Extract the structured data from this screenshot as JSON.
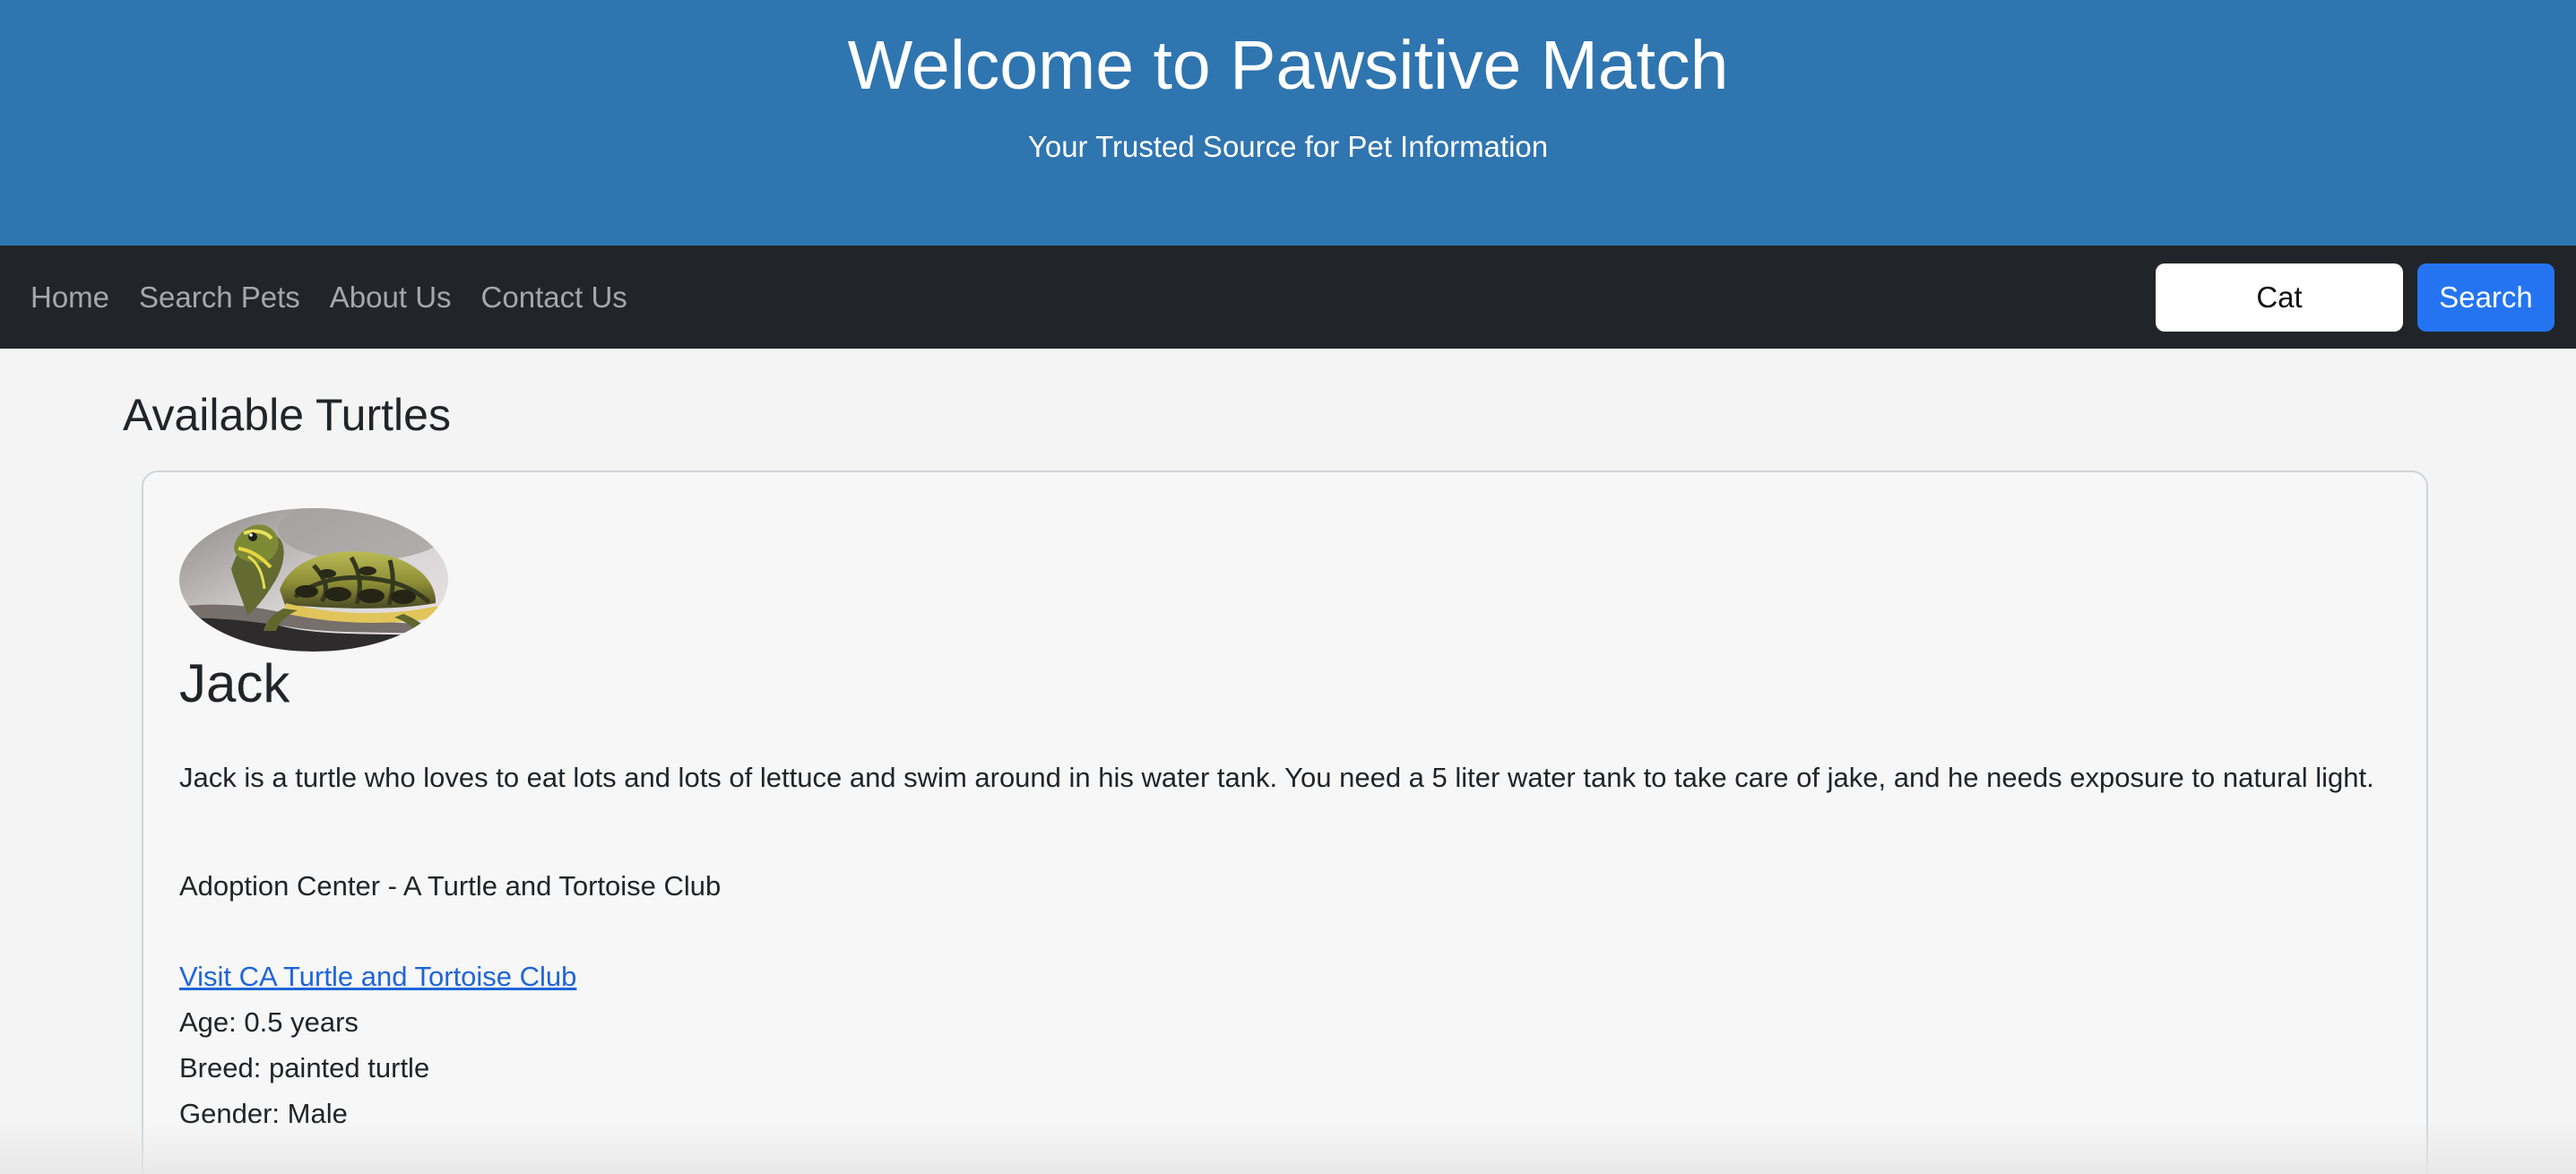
{
  "header": {
    "title": "Welcome to Pawsitive Match",
    "subtitle": "Your Trusted Source for Pet Information",
    "background": "#2f75b0"
  },
  "nav": {
    "links": [
      "Home",
      "Search Pets",
      "About Us",
      "Contact Us"
    ],
    "search_value": "Cat",
    "search_button": "Search"
  },
  "main": {
    "section_title": "Available Turtles",
    "pet": {
      "photo_icon": "turtle-photo",
      "name": "Jack",
      "description": "Jack is a turtle who loves to eat lots and lots of lettuce and swim around in his water tank. You need a 5 liter water tank to take care of jake, and he needs exposure to natural light.",
      "adoption_center": "Adoption Center - A Turtle and Tortoise Club",
      "link_text": "Visit CA Turtle and Tortoise Club",
      "age": "Age: 0.5 years",
      "breed": "Breed: painted turtle",
      "gender": "Gender: Male"
    }
  },
  "colors": {
    "navbar": "#212529",
    "button": "#2474f2",
    "link": "#1f65d8"
  }
}
